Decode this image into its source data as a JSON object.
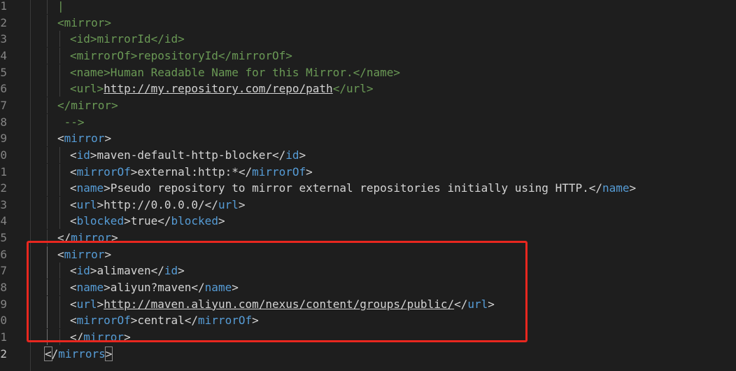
{
  "editor": {
    "lines": [
      {
        "n": "1",
        "indent": 1,
        "tokens": [
          {
            "c": "tg",
            "t": "|"
          }
        ]
      },
      {
        "n": "2",
        "indent": 1,
        "tokens": [
          {
            "c": "tg",
            "t": "<mirror>"
          }
        ]
      },
      {
        "n": "3",
        "indent": 2,
        "tokens": [
          {
            "c": "tg",
            "t": "<id>mirrorId</id>"
          }
        ]
      },
      {
        "n": "4",
        "indent": 2,
        "tokens": [
          {
            "c": "tg",
            "t": "<mirrorOf>repositoryId</mirrorOf>"
          }
        ]
      },
      {
        "n": "5",
        "indent": 2,
        "tokens": [
          {
            "c": "tg",
            "t": "<name>Human Readable Name for this Mirror.</name>"
          }
        ]
      },
      {
        "n": "6",
        "indent": 2,
        "tokens": [
          {
            "c": "tg",
            "t": "<url>"
          },
          {
            "c": "tg lk",
            "t": "http://my.repository.com/repo/path"
          },
          {
            "c": "tg",
            "t": "</url>"
          }
        ]
      },
      {
        "n": "7",
        "indent": 1,
        "tokens": [
          {
            "c": "tg",
            "t": "</mirror>"
          }
        ]
      },
      {
        "n": "8",
        "indent": 1,
        "tokens": [
          {
            "c": "tg",
            "t": " -->"
          }
        ]
      },
      {
        "n": "9",
        "indent": 1,
        "tokens": [
          {
            "c": "tx",
            "t": "<"
          },
          {
            "c": "tb",
            "t": "mirror"
          },
          {
            "c": "tx",
            "t": ">"
          }
        ]
      },
      {
        "n": "0",
        "indent": 2,
        "tokens": [
          {
            "c": "tx",
            "t": "<"
          },
          {
            "c": "tb",
            "t": "id"
          },
          {
            "c": "tx",
            "t": ">maven-default-http-blocker</"
          },
          {
            "c": "tb",
            "t": "id"
          },
          {
            "c": "tx",
            "t": ">"
          }
        ]
      },
      {
        "n": "1",
        "indent": 2,
        "tokens": [
          {
            "c": "tx",
            "t": "<"
          },
          {
            "c": "tb",
            "t": "mirrorOf"
          },
          {
            "c": "tx",
            "t": ">external:http:*</"
          },
          {
            "c": "tb",
            "t": "mirrorOf"
          },
          {
            "c": "tx",
            "t": ">"
          }
        ]
      },
      {
        "n": "2",
        "indent": 2,
        "tokens": [
          {
            "c": "tx",
            "t": "<"
          },
          {
            "c": "tb",
            "t": "name"
          },
          {
            "c": "tx",
            "t": ">Pseudo repository to mirror external repositories initially using HTTP.</"
          },
          {
            "c": "tb",
            "t": "name"
          },
          {
            "c": "tx",
            "t": ">"
          }
        ]
      },
      {
        "n": "3",
        "indent": 2,
        "tokens": [
          {
            "c": "tx",
            "t": "<"
          },
          {
            "c": "tb",
            "t": "url"
          },
          {
            "c": "tx",
            "t": ">http://0.0.0.0/</"
          },
          {
            "c": "tb",
            "t": "url"
          },
          {
            "c": "tx",
            "t": ">"
          }
        ]
      },
      {
        "n": "4",
        "indent": 2,
        "tokens": [
          {
            "c": "tx",
            "t": "<"
          },
          {
            "c": "tb",
            "t": "blocked"
          },
          {
            "c": "tx",
            "t": ">true</"
          },
          {
            "c": "tb",
            "t": "blocked"
          },
          {
            "c": "tx",
            "t": ">"
          }
        ]
      },
      {
        "n": "5",
        "indent": 1,
        "tokens": [
          {
            "c": "tx",
            "t": "</"
          },
          {
            "c": "tb",
            "t": "mirror"
          },
          {
            "c": "tx",
            "t": ">"
          }
        ]
      },
      {
        "n": "6",
        "indent": 1,
        "tokens": [
          {
            "c": "tx",
            "t": "<"
          },
          {
            "c": "tb",
            "t": "mirror"
          },
          {
            "c": "tx",
            "t": ">"
          }
        ]
      },
      {
        "n": "7",
        "indent": 2,
        "tokens": [
          {
            "c": "tx",
            "t": "<"
          },
          {
            "c": "tb",
            "t": "id"
          },
          {
            "c": "tx",
            "t": ">alimaven</"
          },
          {
            "c": "tb",
            "t": "id"
          },
          {
            "c": "tx",
            "t": ">"
          }
        ]
      },
      {
        "n": "8",
        "indent": 2,
        "tokens": [
          {
            "c": "tx",
            "t": "<"
          },
          {
            "c": "tb",
            "t": "name"
          },
          {
            "c": "tx",
            "t": ">aliyun?maven</"
          },
          {
            "c": "tb",
            "t": "name"
          },
          {
            "c": "tx",
            "t": ">"
          }
        ]
      },
      {
        "n": "9",
        "indent": 2,
        "tokens": [
          {
            "c": "tx",
            "t": "<"
          },
          {
            "c": "tb",
            "t": "url"
          },
          {
            "c": "tx",
            "t": ">"
          },
          {
            "c": "lk",
            "t": "http://maven.aliyun.com/nexus/content/groups/public/"
          },
          {
            "c": "tx",
            "t": "</"
          },
          {
            "c": "tb",
            "t": "url"
          },
          {
            "c": "tx",
            "t": ">"
          }
        ]
      },
      {
        "n": "0",
        "indent": 2,
        "tokens": [
          {
            "c": "tx",
            "t": "<"
          },
          {
            "c": "tb",
            "t": "mirrorOf"
          },
          {
            "c": "tx",
            "t": ">central</"
          },
          {
            "c": "tb",
            "t": "mirrorOf"
          },
          {
            "c": "tx",
            "t": ">"
          }
        ]
      },
      {
        "n": "1",
        "indent": 2,
        "tokens": [
          {
            "c": "tx",
            "t": "</"
          },
          {
            "c": "tb",
            "t": "mirror"
          },
          {
            "c": "tx",
            "t": ">"
          }
        ]
      },
      {
        "n": "2",
        "indent": 0,
        "active": true,
        "tokens": [
          {
            "c": "tx mark-box",
            "t": "<"
          },
          {
            "c": "tx",
            "t": "/"
          },
          {
            "c": "tb",
            "t": "mirrors"
          },
          {
            "c": "tx mark-box",
            "t": ">"
          }
        ]
      },
      {
        "n": "",
        "indent": 0,
        "tokens": []
      }
    ]
  }
}
